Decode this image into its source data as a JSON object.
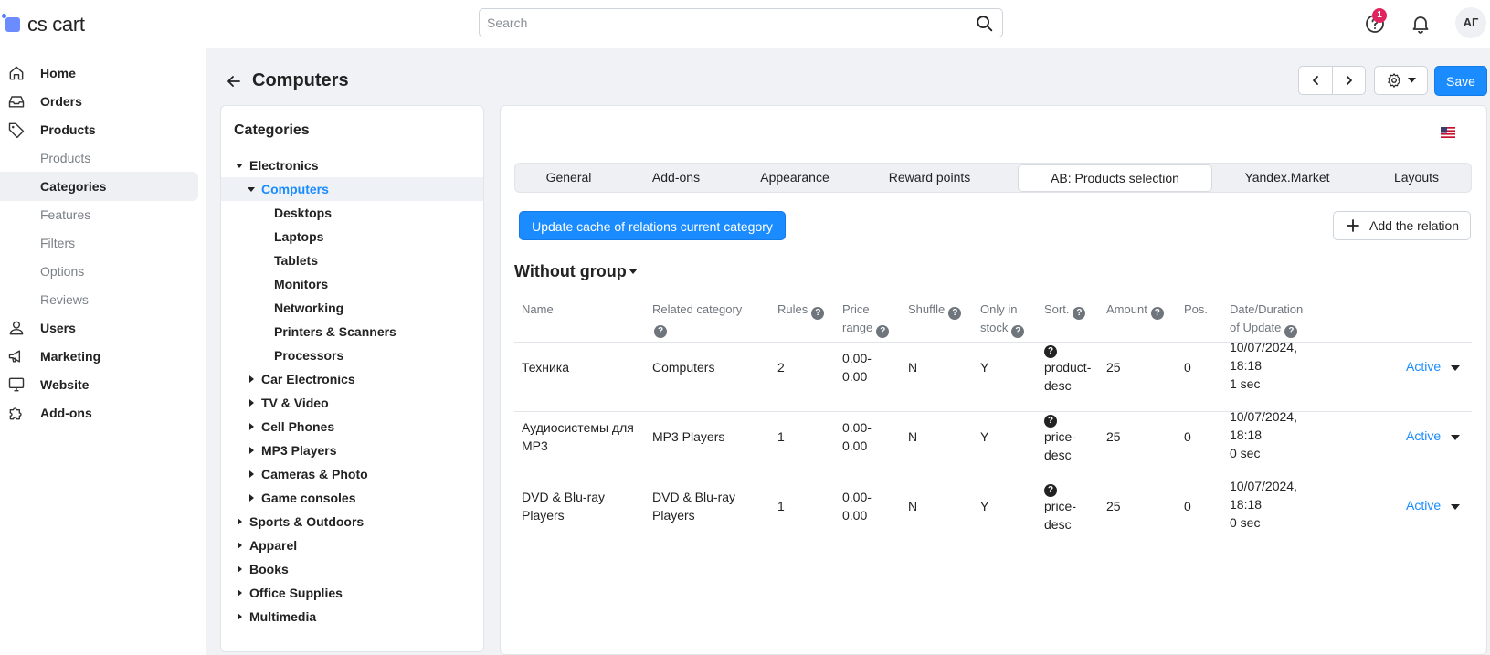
{
  "app": {
    "logo_text": "cs cart",
    "brand_color": "#1a8cff"
  },
  "header": {
    "search_placeholder": "Search",
    "help_badge": "1",
    "avatar_initials": "АГ"
  },
  "sidebar": {
    "items": [
      {
        "label": "Home",
        "icon": "home-icon"
      },
      {
        "label": "Orders",
        "icon": "inbox-icon"
      },
      {
        "label": "Products",
        "icon": "tag-icon"
      },
      {
        "label": "Products",
        "sub": true
      },
      {
        "label": "Categories",
        "sub": true,
        "active": true
      },
      {
        "label": "Features",
        "sub": true
      },
      {
        "label": "Filters",
        "sub": true
      },
      {
        "label": "Options",
        "sub": true
      },
      {
        "label": "Reviews",
        "sub": true
      },
      {
        "label": "Users",
        "icon": "user-icon"
      },
      {
        "label": "Marketing",
        "icon": "megaphone-icon"
      },
      {
        "label": "Website",
        "icon": "monitor-icon"
      },
      {
        "label": "Add-ons",
        "icon": "puzzle-icon"
      }
    ]
  },
  "page": {
    "title": "Computers",
    "save_label": "Save"
  },
  "categories": {
    "title": "Categories",
    "tree": [
      {
        "label": "Electronics",
        "level": 0,
        "caret": "down"
      },
      {
        "label": "Computers",
        "level": 1,
        "caret": "down",
        "active": true
      },
      {
        "label": "Desktops",
        "level": 2
      },
      {
        "label": "Laptops",
        "level": 2
      },
      {
        "label": "Tablets",
        "level": 2
      },
      {
        "label": "Monitors",
        "level": 2
      },
      {
        "label": "Networking",
        "level": 2
      },
      {
        "label": "Printers & Scanners",
        "level": 2
      },
      {
        "label": "Processors",
        "level": 2
      },
      {
        "label": "Car Electronics",
        "level": 1,
        "caret": "right"
      },
      {
        "label": "TV & Video",
        "level": 1,
        "caret": "right"
      },
      {
        "label": "Cell Phones",
        "level": 1,
        "caret": "right"
      },
      {
        "label": "MP3 Players",
        "level": 1,
        "caret": "right"
      },
      {
        "label": "Cameras & Photo",
        "level": 1,
        "caret": "right"
      },
      {
        "label": "Game consoles",
        "level": 1,
        "caret": "right"
      },
      {
        "label": "Sports & Outdoors",
        "level": 0,
        "caret": "right"
      },
      {
        "label": "Apparel",
        "level": 0,
        "caret": "right"
      },
      {
        "label": "Books",
        "level": 0,
        "caret": "right"
      },
      {
        "label": "Office Supplies",
        "level": 0,
        "caret": "right"
      },
      {
        "label": "Multimedia",
        "level": 0,
        "caret": "right"
      }
    ]
  },
  "tabs": [
    {
      "label": "General"
    },
    {
      "label": "Add-ons"
    },
    {
      "label": "Appearance"
    },
    {
      "label": "Reward points"
    },
    {
      "label": "AB: Products selection",
      "active": true
    },
    {
      "label": "Yandex.Market"
    },
    {
      "label": "Layouts"
    }
  ],
  "actions": {
    "update_cache_label": "Update cache of relations current category",
    "add_relation_label": "Add the relation"
  },
  "group": {
    "title": "Without group"
  },
  "table": {
    "headers": {
      "name": "Name",
      "related_category": "Related category",
      "rules": "Rules",
      "price_range": [
        "Price",
        "range"
      ],
      "shuffle": "Shuffle",
      "only_in_stock": [
        "Only in",
        "stock"
      ],
      "sort": "Sort.",
      "amount": "Amount",
      "pos": "Pos.",
      "date": [
        "Date/Duration",
        "of Update"
      ]
    },
    "rows": [
      {
        "name": [
          "Техника"
        ],
        "category": [
          "Computers"
        ],
        "rules": "2",
        "price": [
          "0.00-",
          "0.00"
        ],
        "shuffle": "N",
        "stock": "Y",
        "sort": [
          "product-",
          "desc"
        ],
        "amount": "25",
        "pos": "0",
        "date": [
          "10/07/2024,",
          "18:18",
          "1 sec"
        ],
        "status": "Active"
      },
      {
        "name": [
          "Аудиосистемы для",
          "MP3"
        ],
        "category": [
          "MP3 Players"
        ],
        "rules": "1",
        "price": [
          "0.00-",
          "0.00"
        ],
        "shuffle": "N",
        "stock": "Y",
        "sort": [
          "price-",
          "desc"
        ],
        "amount": "25",
        "pos": "0",
        "date": [
          "10/07/2024,",
          "18:18",
          "0 sec"
        ],
        "status": "Active"
      },
      {
        "name": [
          "DVD & Blu-ray",
          "Players"
        ],
        "category": [
          "DVD & Blu-ray",
          "Players"
        ],
        "rules": "1",
        "price": [
          "0.00-",
          "0.00"
        ],
        "shuffle": "N",
        "stock": "Y",
        "sort": [
          "price-",
          "desc"
        ],
        "amount": "25",
        "pos": "0",
        "date": [
          "10/07/2024,",
          "18:18",
          "0 sec"
        ],
        "status": "Active"
      }
    ]
  }
}
